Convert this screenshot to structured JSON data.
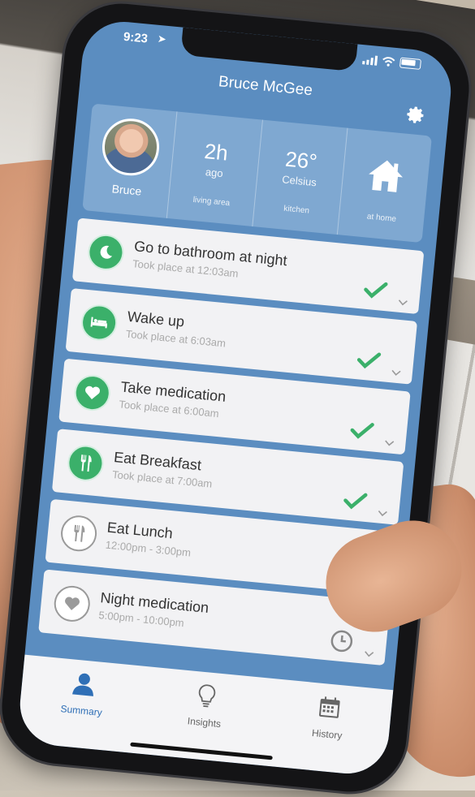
{
  "status": {
    "time": "9:23"
  },
  "header": {
    "title": "Bruce McGee"
  },
  "summary": {
    "person": {
      "name": "Bruce"
    },
    "last_seen": {
      "value": "2h",
      "unit": "ago",
      "place": "living area"
    },
    "temperature": {
      "value": "26°",
      "unit": "Celsius",
      "place": "kitchen"
    },
    "home": {
      "label": "at home"
    }
  },
  "activities": [
    {
      "title": "Go to bathroom at night",
      "subtitle": "Took place at 12:03am",
      "status": "done",
      "icon": "moon-icon"
    },
    {
      "title": "Wake up",
      "subtitle": "Took place at 6:03am",
      "status": "done",
      "icon": "bed-icon"
    },
    {
      "title": "Take medication",
      "subtitle": "Took place at 6:00am",
      "status": "done",
      "icon": "heart-icon"
    },
    {
      "title": "Eat Breakfast",
      "subtitle": "Took place at 7:00am",
      "status": "done",
      "icon": "utensils-icon"
    },
    {
      "title": "Eat Lunch",
      "subtitle": "12:00pm - 3:00pm",
      "status": "pending",
      "icon": "utensils-icon"
    },
    {
      "title": "Night medication",
      "subtitle": "5:00pm - 10:00pm",
      "status": "pending",
      "icon": "heart-icon"
    }
  ],
  "tabs": [
    {
      "label": "Summary",
      "icon": "person-icon",
      "active": true
    },
    {
      "label": "Insights",
      "icon": "lightbulb-icon",
      "active": false
    },
    {
      "label": "History",
      "icon": "calendar-icon",
      "active": false
    }
  ],
  "colors": {
    "primary": "#5b8dc0",
    "panel": "#7fa8d1",
    "success": "#3bb06a",
    "active_tab": "#2f6fb6"
  }
}
